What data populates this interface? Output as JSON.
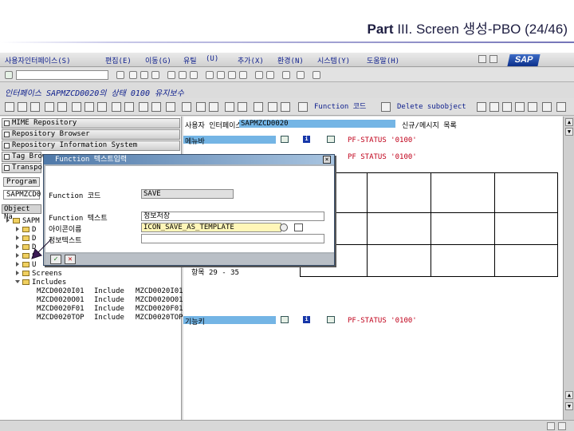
{
  "slide": {
    "title_part": "Part",
    "title_roman": "III.",
    "title_rest": "Screen 생성-PBO (24/46)"
  },
  "menubar": {
    "items": [
      "사용자인터페이스(S)",
      "편집(E)",
      "이동(G)",
      "유틸",
      "(U)",
      "추가(X)",
      "환경(N)",
      "시스템(Y)",
      "도움말(H)"
    ],
    "logo": "SAP"
  },
  "titlebar": {
    "text": "인터페이스 SAPMZCD0020의 상태 0100 유지보수"
  },
  "toolbar2": {
    "function_code_label": "Function 코드",
    "delete_subobject_label": "Delete subobject"
  },
  "navigator": {
    "buttons": [
      "MIME Repository",
      "Repository Browser",
      "Repository Information System",
      "Tag Brow",
      "Transpo"
    ],
    "program_label": "Program",
    "program_value": "SAPMZCD0",
    "object_header": "Object Na",
    "tree": [
      {
        "text": "SAPM",
        "indent": 0
      },
      {
        "text": "D",
        "indent": 1
      },
      {
        "text": "D",
        "indent": 1
      },
      {
        "text": "D",
        "indent": 1
      },
      {
        "text": "S",
        "indent": 1
      },
      {
        "text": "U",
        "indent": 1
      },
      {
        "text": "Screens",
        "indent": 1
      },
      {
        "text": "Includes",
        "indent": 1
      }
    ],
    "includes": [
      {
        "name": "MZCD0020I01",
        "type": "Include",
        "desc": "MZCD0020I01"
      },
      {
        "name": "MZCD0020O01",
        "type": "Include",
        "desc": "MZCD0020O01"
      },
      {
        "name": "MZCD0020F01",
        "type": "Include",
        "desc": "MZCD0020F01"
      },
      {
        "name": "MZCD0020TOP",
        "type": "Include",
        "desc": "MZCD0020TOP"
      }
    ]
  },
  "right_pane": {
    "user_interface_label": "사용자 인터페이스",
    "user_interface_value": "SAPMZCD0020",
    "user_interface_status": "신규/메시지 목록",
    "menu_bar_label": "메뉴바",
    "pf_status_1": "PF-STATUS '0100'",
    "pf_status_2": "PF STATUS '0100'",
    "pf_status_3": "PF-STATUS '0100'",
    "pf_status_4": "PF-STATUS '0100'",
    "item_range": "항목 29 - 35",
    "function_keys_label": "기능키"
  },
  "dialog": {
    "title": "Function 텍스트입력",
    "close": "×",
    "function_code_label": "Function 코드",
    "function_code_value": "SAVE",
    "function_text_label": "Function 텍스트",
    "function_text_value": "정보저장",
    "icon_name_label": "아이콘이름",
    "icon_name_value": "ICON_SAVE_AS_TEMPLATE",
    "info_text_label": "정보텍스트",
    "info_text_value": "",
    "confirm": "✓",
    "cancel": "✕"
  }
}
